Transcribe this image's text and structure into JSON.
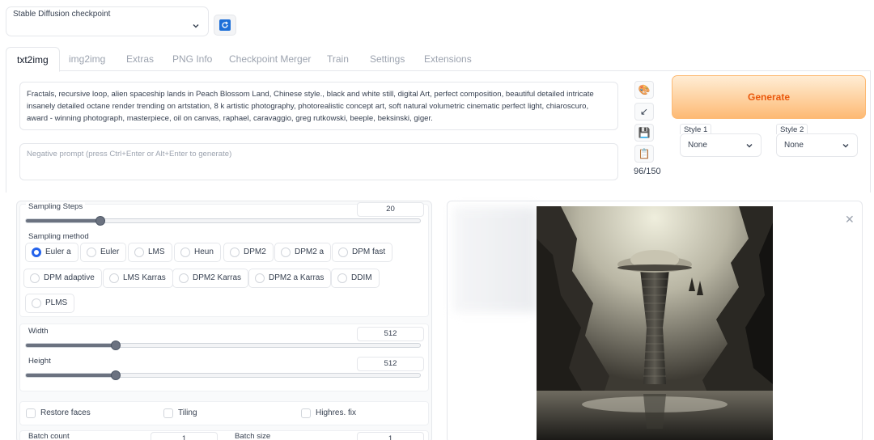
{
  "checkpoint": {
    "label": "Stable Diffusion checkpoint",
    "value": ""
  },
  "tabs": [
    {
      "label": "txt2img",
      "active": true
    },
    {
      "label": "img2img"
    },
    {
      "label": "Extras"
    },
    {
      "label": "PNG Info"
    },
    {
      "label": "Checkpoint Merger"
    },
    {
      "label": "Train"
    },
    {
      "label": "Settings"
    },
    {
      "label": "Extensions"
    }
  ],
  "prompt": {
    "text": "Fractals, recursive loop, alien spaceship lands in Peach Blossom Land, Chinese style., black and white still, digital Art, perfect composition, beautiful detailed intricate insanely detailed octane render trending on artstation, 8 k artistic photography, photorealistic concept art, soft natural volumetric cinematic perfect light, chiaroscuro, award - winning photograph, masterpiece, oil on canvas, raphael, caravaggio, greg rutkowski, beeple, beksinski, giger.",
    "negative_placeholder": "Negative prompt (press Ctrl+Enter or Alt+Enter to generate)",
    "token_count": "96/150"
  },
  "tools": {
    "icons": [
      "palette-icon",
      "arrow-icon",
      "save-icon",
      "clipboard-icon"
    ],
    "glyphs": [
      "🎨",
      "↙",
      "💾",
      "📋"
    ]
  },
  "generate": {
    "label": "Generate",
    "color": "#ea580c"
  },
  "styles": [
    {
      "label": "Style 1",
      "value": "None"
    },
    {
      "label": "Style 2",
      "value": "None"
    }
  ],
  "sampling_steps": {
    "label": "Sampling Steps",
    "value": "20",
    "level": 0.19
  },
  "sampling_method": {
    "label": "Sampling method",
    "options": [
      "Euler a",
      "Euler",
      "LMS",
      "Heun",
      "DPM2",
      "DPM2 a",
      "DPM fast",
      "DPM adaptive",
      "LMS Karras",
      "DPM2 Karras",
      "DPM2 a Karras",
      "DDIM",
      "PLMS"
    ],
    "selected": "Euler a"
  },
  "width": {
    "label": "Width",
    "value": "512",
    "level": 0.23
  },
  "height": {
    "label": "Height",
    "value": "512",
    "level": 0.23
  },
  "checkboxes": [
    {
      "label": "Restore faces",
      "checked": false
    },
    {
      "label": "Tiling",
      "checked": false
    },
    {
      "label": "Highres. fix",
      "checked": false
    }
  ],
  "batch_count": {
    "label": "Batch count",
    "value": "1"
  },
  "batch_size": {
    "label": "Batch size",
    "value": "1"
  },
  "colors": {
    "accent": "#2563eb",
    "generate_bg": "#fdba74",
    "refresh": "#1d6fd8"
  }
}
